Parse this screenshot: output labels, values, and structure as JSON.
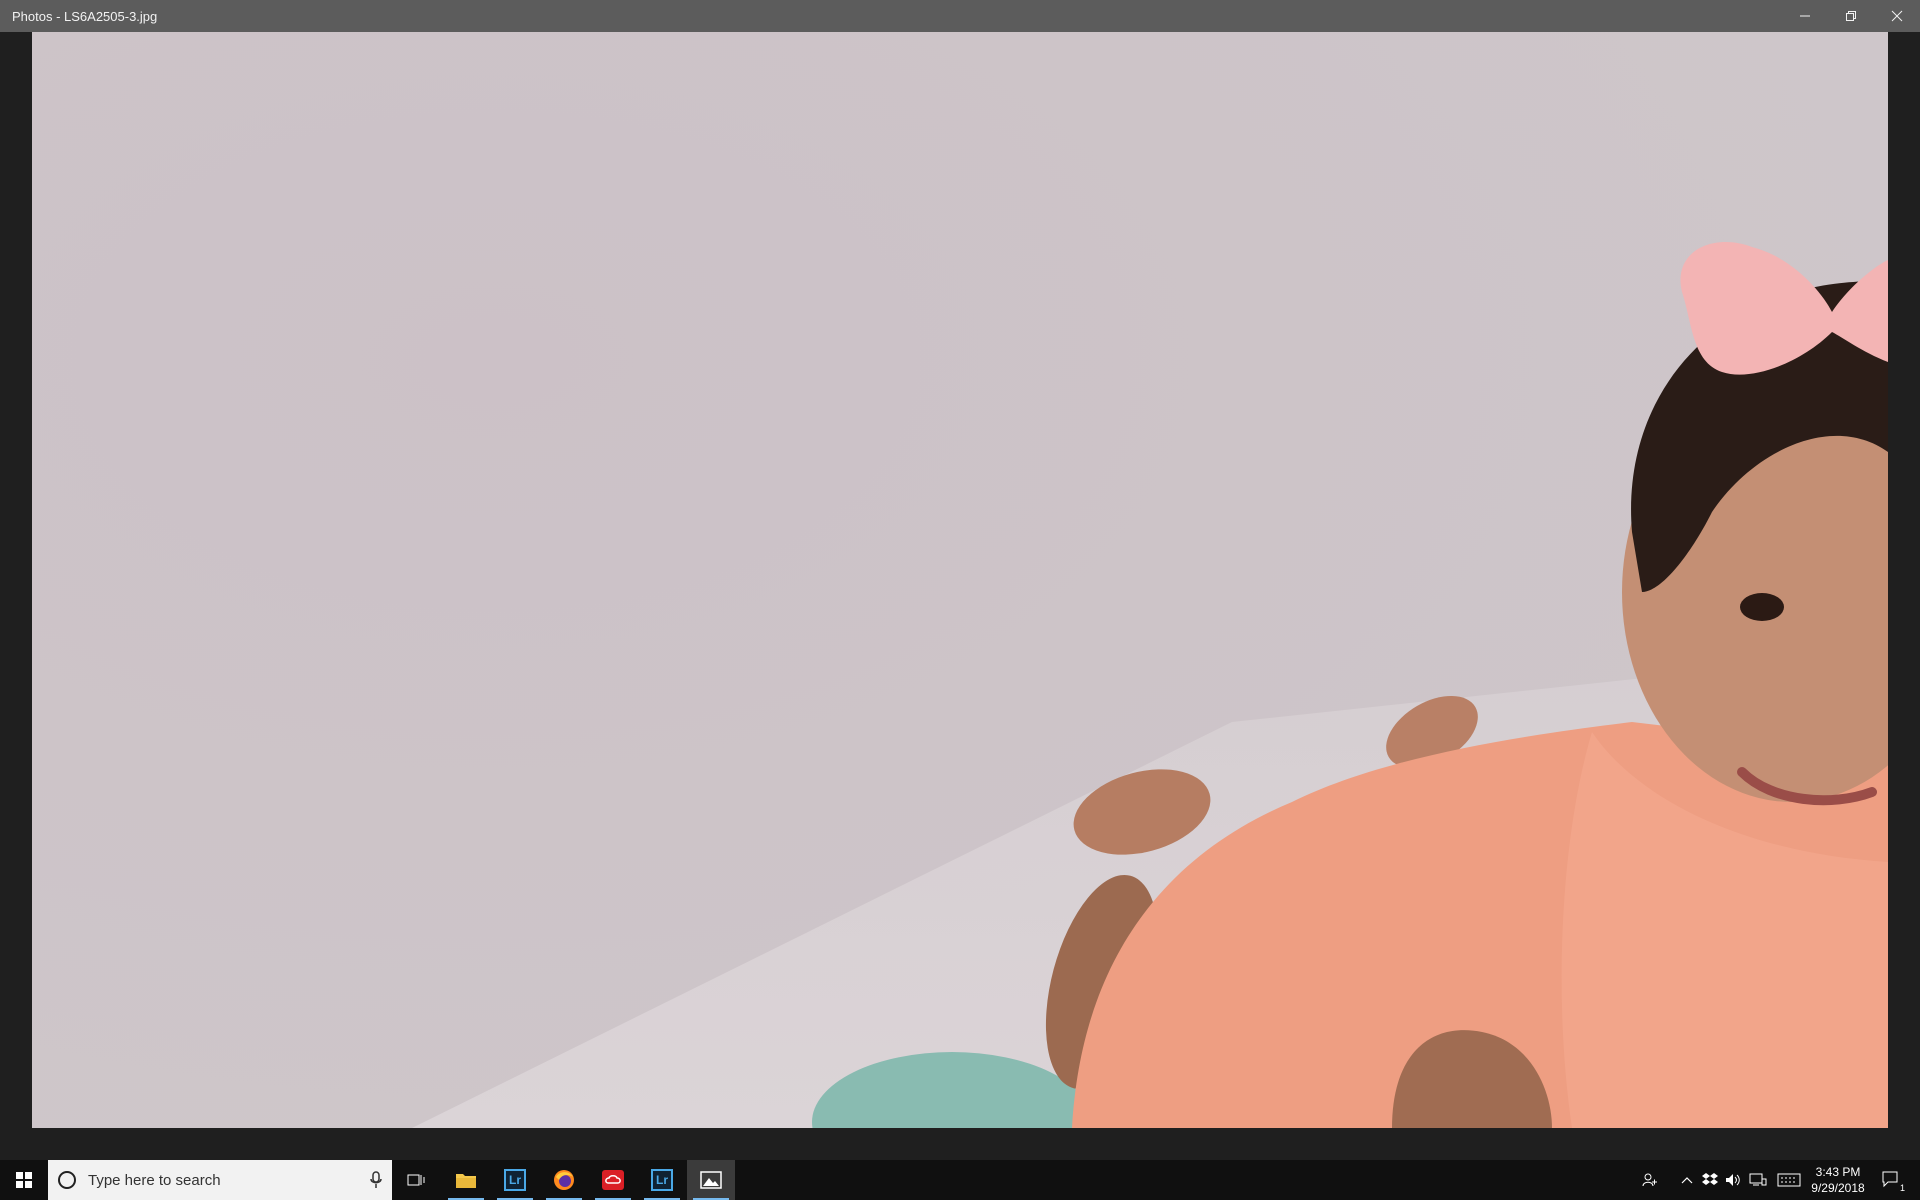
{
  "window": {
    "title": "Photos - LS6A2505-3.jpg",
    "controls": [
      "minimize-icon",
      "restore-icon",
      "close-icon"
    ]
  },
  "photo": {
    "description_icon": "photo-image"
  },
  "taskbar": {
    "start_icon": "windows-logo-icon",
    "search": {
      "placeholder": "Type here to search",
      "icon": "cortana-circle-icon",
      "mic_icon": "microphone-icon"
    },
    "apps": [
      {
        "name": "task-view",
        "icon": "task-view-icon"
      },
      {
        "name": "file-explorer",
        "icon": "folder-icon"
      },
      {
        "name": "lightroom",
        "icon": "lr-icon",
        "label": "Lr"
      },
      {
        "name": "firefox",
        "icon": "firefox-icon"
      },
      {
        "name": "creative-cloud",
        "icon": "creative-cloud-icon"
      },
      {
        "name": "lightroom-classic",
        "icon": "lr-icon",
        "label": "Lr"
      },
      {
        "name": "photos",
        "icon": "photos-icon"
      }
    ],
    "tray": [
      "people-icon",
      "chevron-up-icon",
      "dropbox-icon",
      "volume-icon",
      "network-icon",
      "keyboard-icon"
    ],
    "clock": {
      "time": "3:43 PM",
      "date": "9/29/2018"
    },
    "notifications": {
      "icon": "action-center-icon",
      "count": "1"
    }
  },
  "colors": {
    "titlebar": "#5c5c5c",
    "taskbar": "#101010",
    "accent": "#76b9ed"
  }
}
